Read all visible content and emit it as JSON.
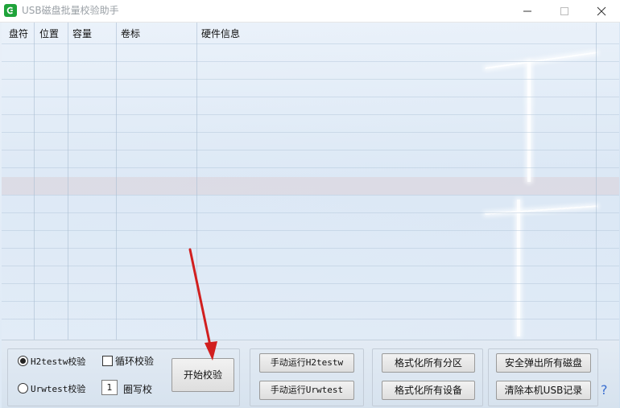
{
  "window": {
    "title": "USB磁盘批量校验助手"
  },
  "table": {
    "columns": [
      "盘符",
      "位置",
      "容量",
      "卷标",
      "硬件信息"
    ]
  },
  "options": {
    "radio_h2": "H2testw校验",
    "radio_urw": "Urwtest校验",
    "loop_check": "循环校验",
    "loop_count": "1",
    "loop_count_suffix": "圈写校",
    "selected_mode": "H2testw校验"
  },
  "buttons": {
    "start": "开始校验",
    "run_h2": "手动运行H2testw",
    "run_urw": "手动运行Urwtest",
    "format_partitions": "格式化所有分区",
    "format_devices": "格式化所有设备",
    "eject_all": "安全弹出所有磁盘",
    "clear_usb": "清除本机USB记录",
    "help": "?"
  },
  "colors": {
    "app_icon": "#1fa33a",
    "arrow": "#d11f1f",
    "help": "#3a6fd0"
  }
}
